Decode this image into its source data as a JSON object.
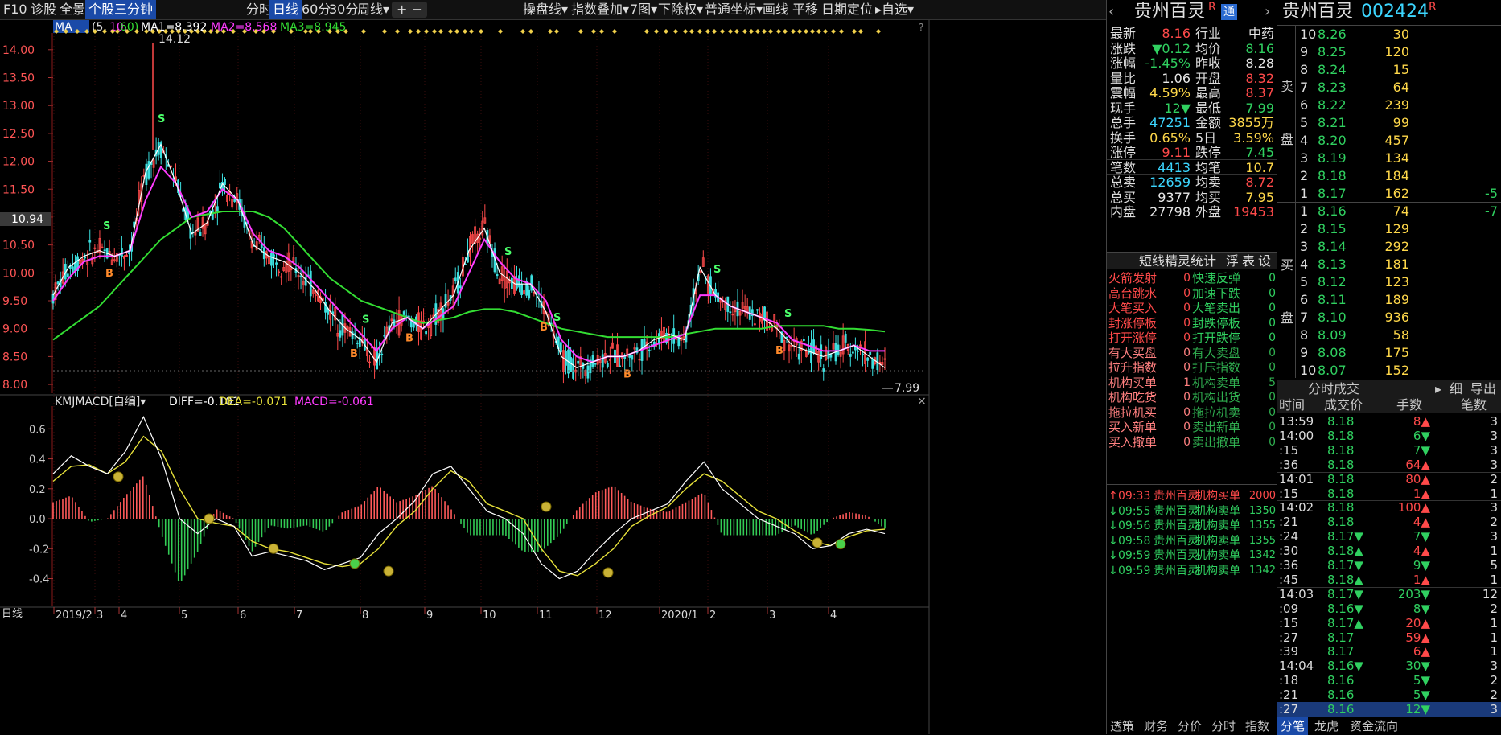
{
  "toolbar": {
    "left": [
      "F10",
      "诊股",
      "全景",
      "个股三分钟"
    ],
    "periods": [
      "分时",
      "日线",
      "60分",
      "30分",
      "周线▾"
    ],
    "tools": [
      "操盘线▾",
      "指数叠加▾",
      "7图▾",
      "下除权▾",
      "普通坐标▾",
      "画线",
      "平移",
      "日期定位",
      "▸自选▾"
    ],
    "plus": "+",
    "minus": "−"
  },
  "ma_bar": {
    "name": "MA",
    "params_prefix": "(5,",
    "p2": "10,",
    "p3": "60)",
    "ma1": "MA1=8.392",
    "ma2": "MA2=8.568",
    "ma3": "MA3=8.945",
    "q": "?"
  },
  "macd_bar": {
    "name": "KMJMACD[自编]▾",
    "diff": "DIFF=-0.101",
    "dea": "DEA=-0.071",
    "macd": "MACD=-0.061"
  },
  "price_axis": [
    "14.00",
    "13.50",
    "13.00",
    "12.50",
    "12.00",
    "11.50",
    "11.00",
    "10.50",
    "10.00",
    "9.50",
    "9.00",
    "8.50",
    "8.00"
  ],
  "cur_price_tag": "10.94",
  "high_label": "14.12",
  "low_label": "7.99",
  "macd_axis": [
    "0.6",
    "0.4",
    "0.2",
    "0.0",
    "-0.2",
    "-0.4"
  ],
  "date_axis": [
    "2019/2",
    "3",
    "4",
    "5",
    "6",
    "7",
    "8",
    "9",
    "10",
    "11",
    "12",
    "2020/1",
    "2",
    "3",
    "4"
  ],
  "bottom_left": "日线",
  "signals": {
    "buy": "B",
    "sell": "S"
  },
  "chart_data": {
    "type": "line",
    "series": [
      {
        "name": "MA1",
        "values": [
          9.6,
          10.1,
          10.3,
          10.4,
          10.3,
          10.4,
          11.8,
          12.3,
          11.6,
          10.7,
          10.9,
          11.6,
          11.3,
          10.5,
          10.3,
          10.2,
          10.0,
          9.7,
          9.3,
          9.0,
          8.8,
          8.4,
          9.1,
          9.2,
          9.0,
          9.3,
          9.6,
          10.4,
          10.8,
          10.0,
          9.8,
          9.8,
          9.3,
          8.5,
          8.3,
          8.4,
          8.5,
          8.5,
          8.6,
          8.8,
          8.9,
          8.8,
          10.1,
          9.6,
          9.4,
          9.3,
          9.2,
          9.0,
          8.7,
          8.6,
          8.5,
          8.6,
          8.7,
          8.5,
          8.3
        ]
      },
      {
        "name": "MA2",
        "values": [
          9.5,
          9.9,
          10.2,
          10.3,
          10.3,
          10.4,
          11.3,
          11.9,
          11.6,
          11.0,
          11.1,
          11.5,
          11.3,
          10.7,
          10.4,
          10.3,
          10.1,
          9.8,
          9.5,
          9.2,
          8.9,
          8.6,
          9.0,
          9.2,
          9.0,
          9.2,
          9.4,
          10.0,
          10.6,
          10.2,
          9.9,
          9.8,
          9.5,
          8.8,
          8.5,
          8.4,
          8.5,
          8.5,
          8.6,
          8.7,
          8.8,
          8.9,
          9.6,
          9.6,
          9.4,
          9.3,
          9.2,
          9.1,
          8.8,
          8.7,
          8.6,
          8.6,
          8.7,
          8.6,
          8.6
        ]
      },
      {
        "name": "MA3",
        "values": [
          8.8,
          9.0,
          9.2,
          9.4,
          9.7,
          10.0,
          10.3,
          10.6,
          10.8,
          11.0,
          11.05,
          11.1,
          11.1,
          11.1,
          11.0,
          10.8,
          10.5,
          10.2,
          9.9,
          9.7,
          9.5,
          9.4,
          9.3,
          9.2,
          9.1,
          9.15,
          9.2,
          9.3,
          9.35,
          9.35,
          9.3,
          9.2,
          9.1,
          9.0,
          8.95,
          8.9,
          8.85,
          8.85,
          8.85,
          8.85,
          8.85,
          8.9,
          8.95,
          9.0,
          9.0,
          9.0,
          9.0,
          9.05,
          9.05,
          9.05,
          9.05,
          9.0,
          9.0,
          8.98,
          8.95
        ]
      }
    ],
    "ylim": [
      7.9,
      14.3
    ],
    "macd": {
      "diff": [
        0.3,
        0.42,
        0.35,
        0.3,
        0.45,
        0.68,
        0.4,
        0.0,
        -0.1,
        0.0,
        -0.05,
        -0.25,
        -0.22,
        -0.25,
        -0.28,
        -0.34,
        -0.3,
        -0.26,
        -0.1,
        0.0,
        0.12,
        0.3,
        0.35,
        0.2,
        0.05,
        0.0,
        -0.1,
        -0.3,
        -0.4,
        -0.35,
        -0.22,
        -0.1,
        0.0,
        0.05,
        0.1,
        0.25,
        0.38,
        0.2,
        0.1,
        0.0,
        -0.05,
        -0.1,
        -0.2,
        -0.18,
        -0.1,
        -0.07,
        -0.1
      ],
      "dea": [
        0.25,
        0.35,
        0.36,
        0.3,
        0.38,
        0.55,
        0.45,
        0.2,
        0.0,
        -0.03,
        -0.05,
        -0.15,
        -0.2,
        -0.22,
        -0.26,
        -0.3,
        -0.32,
        -0.3,
        -0.2,
        -0.05,
        0.05,
        0.2,
        0.32,
        0.25,
        0.1,
        0.05,
        0.0,
        -0.2,
        -0.35,
        -0.38,
        -0.3,
        -0.2,
        -0.05,
        0.02,
        0.08,
        0.2,
        0.3,
        0.25,
        0.15,
        0.05,
        0.0,
        -0.08,
        -0.15,
        -0.18,
        -0.12,
        -0.08,
        -0.07
      ],
      "ylim": [
        -0.58,
        0.72
      ]
    }
  },
  "quote": {
    "title": "贵州百灵",
    "r": "R",
    "tong": "通",
    "rows": [
      [
        "最新",
        "8.16",
        "行业",
        "中药"
      ],
      [
        "涨跌",
        "▼0.12",
        "均价",
        "8.16"
      ],
      [
        "涨幅",
        "-1.45%",
        "昨收",
        "8.28"
      ],
      [
        "量比",
        "1.06",
        "开盘",
        "8.32"
      ],
      [
        "震幅",
        "4.59%",
        "最高",
        "8.37"
      ],
      [
        "现手",
        "12▼",
        "最低",
        "7.99"
      ],
      [
        "总手",
        "47251",
        "金额",
        "3855万"
      ],
      [
        "换手",
        "0.65%",
        "5日",
        "3.59%"
      ],
      [
        "涨停",
        "9.11",
        "跌停",
        "7.45"
      ],
      [
        "笔数",
        "4413",
        "均笔",
        "10.7"
      ],
      [
        "总卖",
        "12659",
        "均卖",
        "8.72"
      ],
      [
        "总买",
        "9377",
        "均买",
        "7.95"
      ],
      [
        "内盘",
        "27798",
        "外盘",
        "19453"
      ]
    ]
  },
  "sprite": {
    "title": "短线精灵统计",
    "opts": [
      "浮",
      "表",
      "设"
    ],
    "rows": [
      [
        "火箭发射",
        "0",
        "快速反弹",
        "0"
      ],
      [
        "高台跳水",
        "0",
        "加速下跌",
        "0"
      ],
      [
        "大笔买入",
        "0",
        "大笔卖出",
        "0"
      ],
      [
        "封涨停板",
        "0",
        "封跌停板",
        "0"
      ],
      [
        "打开涨停",
        "0",
        "打开跌停",
        "0"
      ],
      [
        "有大买盘",
        "0",
        "有大卖盘",
        "0"
      ],
      [
        "拉升指数",
        "0",
        "打压指数",
        "0"
      ],
      [
        "机构买单",
        "1",
        "机构卖单",
        "5"
      ],
      [
        "机构吃货",
        "0",
        "机构出货",
        "0"
      ],
      [
        "拖拉机买",
        "0",
        "拖拉机卖",
        "0"
      ],
      [
        "买入新单",
        "0",
        "卖出新单",
        "0"
      ],
      [
        "买入撤单",
        "0",
        "卖出撤单",
        "0"
      ]
    ],
    "events": [
      [
        "↑",
        "09:33",
        "贵州百灵",
        "机构买单",
        "2000"
      ],
      [
        "↓",
        "09:55",
        "贵州百灵",
        "机构卖单",
        "1350"
      ],
      [
        "↓",
        "09:56",
        "贵州百灵",
        "机构卖单",
        "1355"
      ],
      [
        "↓",
        "09:58",
        "贵州百灵",
        "机构卖单",
        "1355"
      ],
      [
        "↓",
        "09:59",
        "贵州百灵",
        "机构卖单",
        "1342"
      ],
      [
        "↓",
        "09:59",
        "贵州百灵",
        "机构卖单",
        "1342"
      ]
    ],
    "tabs": [
      "透策",
      "财务",
      "分价",
      "分时",
      "指数"
    ]
  },
  "book": {
    "title": "贵州百灵",
    "code": "002424",
    "r": "R",
    "sell_label": [
      "卖",
      "盘"
    ],
    "buy_label": [
      "买",
      "盘"
    ],
    "sell": [
      [
        "10",
        "8.26",
        "30",
        ""
      ],
      [
        "9",
        "8.25",
        "120",
        ""
      ],
      [
        "8",
        "8.24",
        "15",
        ""
      ],
      [
        "7",
        "8.23",
        "64",
        ""
      ],
      [
        "6",
        "8.22",
        "239",
        ""
      ],
      [
        "5",
        "8.21",
        "99",
        ""
      ],
      [
        "4",
        "8.20",
        "457",
        ""
      ],
      [
        "3",
        "8.19",
        "134",
        ""
      ],
      [
        "2",
        "8.18",
        "184",
        ""
      ],
      [
        "1",
        "8.17",
        "162",
        "-5"
      ]
    ],
    "buy": [
      [
        "1",
        "8.16",
        "74",
        "-7"
      ],
      [
        "2",
        "8.15",
        "129",
        ""
      ],
      [
        "3",
        "8.14",
        "292",
        ""
      ],
      [
        "4",
        "8.13",
        "181",
        ""
      ],
      [
        "5",
        "8.12",
        "123",
        ""
      ],
      [
        "6",
        "8.11",
        "189",
        ""
      ],
      [
        "7",
        "8.10",
        "936",
        ""
      ],
      [
        "8",
        "8.09",
        "58",
        ""
      ],
      [
        "9",
        "8.08",
        "175",
        ""
      ],
      [
        "10",
        "8.07",
        "152",
        ""
      ]
    ]
  },
  "ticks": {
    "title": "分时成交",
    "fine": "细",
    "exit": "导出",
    "headers": [
      "时间",
      "成交价",
      "手数",
      "笔数"
    ],
    "rows": [
      [
        "13:59",
        "8.18",
        "8▲",
        "3"
      ],
      [
        "14:00",
        "8.18",
        "6▼",
        "3"
      ],
      [
        ":15",
        "8.18",
        "7▼",
        "3"
      ],
      [
        ":36",
        "8.18",
        "64▲",
        "3"
      ],
      [
        "14:01",
        "8.18",
        "80▲",
        "2"
      ],
      [
        ":15",
        "8.18",
        "1▲",
        "1"
      ],
      [
        "14:02",
        "8.18",
        "100▲",
        "3"
      ],
      [
        ":21",
        "8.18",
        "4▲",
        "2"
      ],
      [
        ":24",
        "8.17▼",
        "7▼",
        "3"
      ],
      [
        ":30",
        "8.18▲",
        "4▲",
        "1"
      ],
      [
        ":36",
        "8.17▼",
        "9▼",
        "5"
      ],
      [
        ":45",
        "8.18▲",
        "1▲",
        "1"
      ],
      [
        "14:03",
        "8.17▼",
        "203▼",
        "12"
      ],
      [
        ":09",
        "8.16▼",
        "8▼",
        "2"
      ],
      [
        ":15",
        "8.17▲",
        "20▲",
        "1"
      ],
      [
        ":27",
        "8.17",
        "59▲",
        "1"
      ],
      [
        ":39",
        "8.17",
        "6▲",
        "1"
      ],
      [
        "14:04",
        "8.16▼",
        "30▼",
        "3"
      ],
      [
        ":18",
        "8.16",
        "5▼",
        "2"
      ],
      [
        ":21",
        "8.16",
        "5▼",
        "2"
      ],
      [
        ":27",
        "8.16",
        "12▼",
        "3"
      ]
    ],
    "tabs": [
      "分笔",
      "龙虎",
      "资金流向"
    ]
  },
  "colors": {
    "up": "#ff4a4a",
    "down": "#3ce0e0",
    "ma1": "#ffffff",
    "ma2": "#ff3cff",
    "ma3": "#33dd33",
    "dea": "#e8e23a",
    "grid": "#7a1a1a"
  }
}
